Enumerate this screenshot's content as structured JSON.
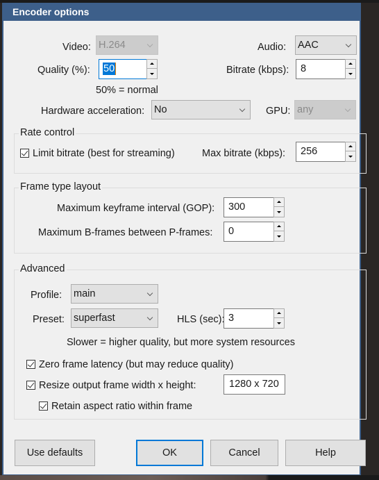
{
  "window": {
    "title": "Encoder options",
    "accent_color": "#3d5f8a"
  },
  "general": {
    "video_label": "Video:",
    "video_value": "H.264",
    "audio_label": "Audio:",
    "audio_value": "AAC",
    "quality_label": "Quality (%):",
    "quality_value": "50",
    "quality_hint": "50% = normal",
    "bitrate_label": "Bitrate (kbps):",
    "bitrate_value": "8",
    "hwaccel_label": "Hardware acceleration:",
    "hwaccel_value": "No",
    "gpu_label": "GPU:",
    "gpu_value": "any"
  },
  "rate_control": {
    "legend": "Rate control",
    "limit_bitrate_label": "Limit bitrate (best for streaming)",
    "limit_bitrate_checked": true,
    "max_bitrate_label": "Max bitrate (kbps):",
    "max_bitrate_value": "256"
  },
  "frame_type": {
    "legend": "Frame type layout",
    "gop_label": "Maximum keyframe interval (GOP):",
    "gop_value": "300",
    "bframes_label": "Maximum B-frames between P-frames:",
    "bframes_value": "0"
  },
  "advanced": {
    "legend": "Advanced",
    "profile_label": "Profile:",
    "profile_value": "main",
    "preset_label": "Preset:",
    "preset_value": "superfast",
    "hls_label": "HLS (sec):",
    "hls_value": "3",
    "preset_hint": "Slower = higher quality, but more system resources",
    "zero_latency_label": "Zero frame latency (but may reduce quality)",
    "zero_latency_checked": true,
    "resize_label": "Resize output frame width x height:",
    "resize_checked": true,
    "resize_value": "1280 x 720",
    "retain_aspect_label": "Retain aspect ratio within frame",
    "retain_aspect_checked": true
  },
  "buttons": {
    "use_defaults": "Use defaults",
    "ok": "OK",
    "cancel": "Cancel",
    "help": "Help"
  }
}
